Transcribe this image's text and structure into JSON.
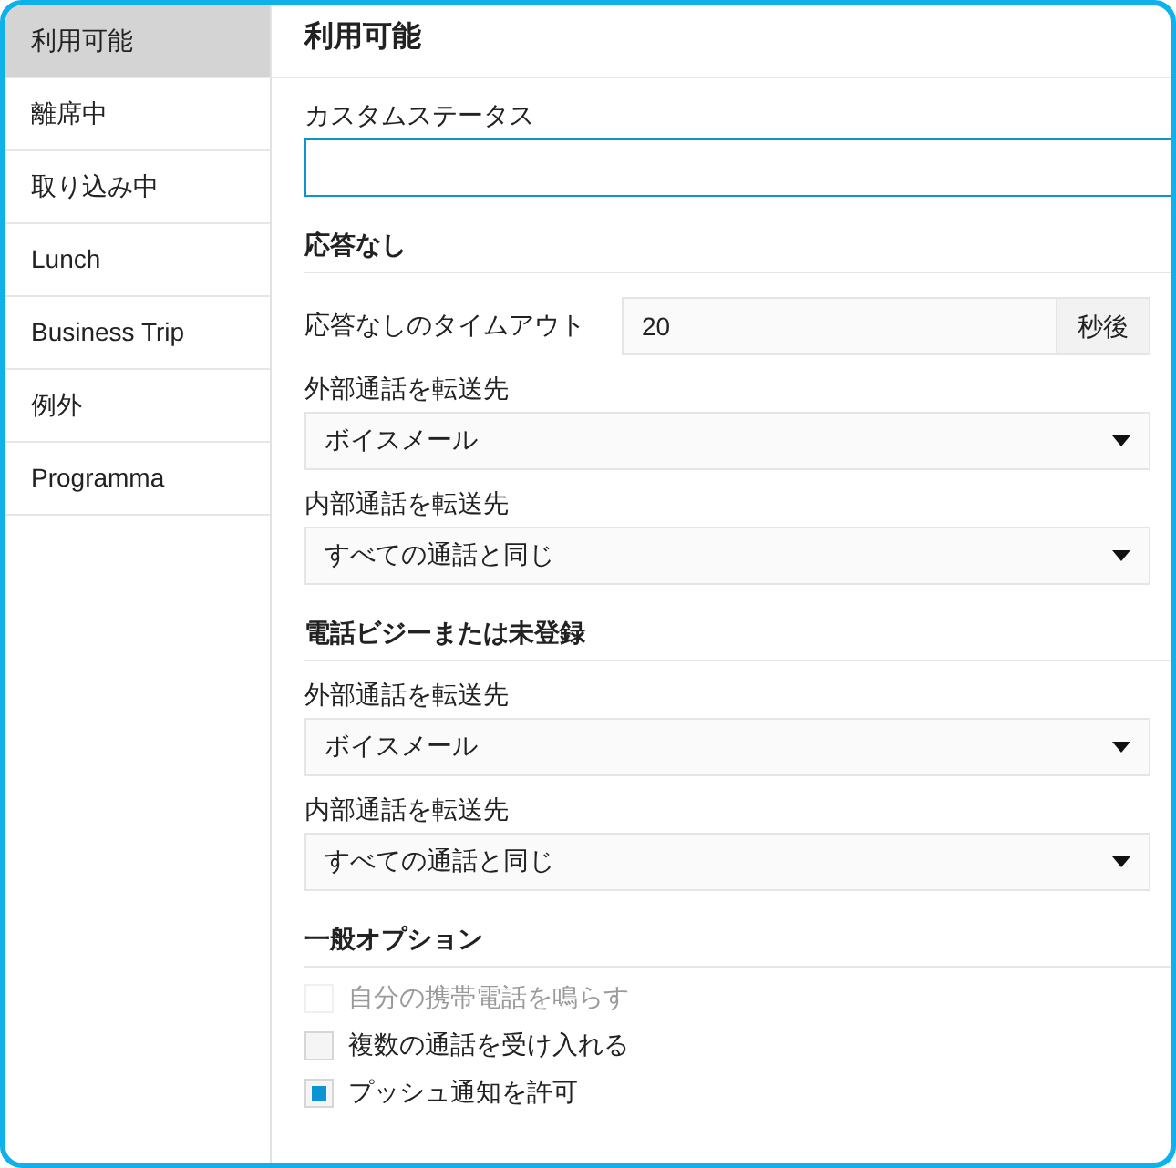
{
  "sidebar": {
    "items": [
      {
        "label": "利用可能",
        "selected": true
      },
      {
        "label": "離席中",
        "selected": false
      },
      {
        "label": "取り込み中",
        "selected": false
      },
      {
        "label": "Lunch",
        "selected": false
      },
      {
        "label": "Business Trip",
        "selected": false
      },
      {
        "label": "例外",
        "selected": false
      },
      {
        "label": "Programma",
        "selected": false
      }
    ]
  },
  "title": "利用可能",
  "custom_status": {
    "label": "カスタムステータス"
  },
  "sections": [
    {
      "heading": "応答なし",
      "fields": [
        {
          "kind": "number",
          "label": "応答なしのタイムアウト",
          "value": "20",
          "unit": "秒後"
        },
        {
          "kind": "select",
          "label": "外部通話を転送先",
          "value": "ボイスメール"
        },
        {
          "kind": "select",
          "label": "内部通話を転送先",
          "value": "すべての通話と同じ"
        }
      ]
    },
    {
      "heading": "電話ビジーまたは未登録",
      "fields": [
        {
          "kind": "select",
          "label": "外部通話を転送先",
          "value": "ボイスメール"
        },
        {
          "kind": "select",
          "label": "内部通話を転送先",
          "value": "すべての通話と同じ"
        }
      ]
    },
    {
      "heading": "一般オプション",
      "fields": [
        {
          "kind": "checkbox",
          "label": "自分の携帯電話を鳴らす",
          "checked": false,
          "disabled": true
        },
        {
          "kind": "checkbox",
          "label": "複数の通話を受け入れる",
          "checked": false,
          "disabled": false
        },
        {
          "kind": "checkbox",
          "label": "プッシュ通知を許可",
          "checked": true,
          "disabled": false
        }
      ]
    }
  ]
}
